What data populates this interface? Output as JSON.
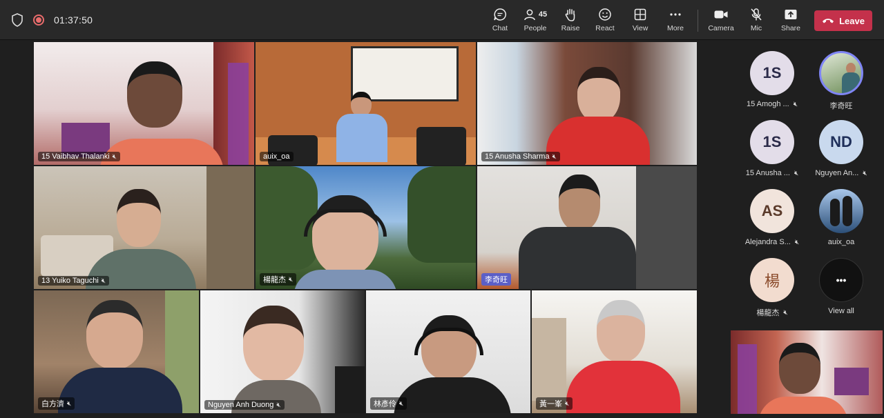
{
  "meeting": {
    "elapsed": "01:37:50"
  },
  "toolbar": {
    "chat": "Chat",
    "people": "People",
    "people_count": "45",
    "raise": "Raise",
    "react": "React",
    "view": "View",
    "more": "More",
    "camera": "Camera",
    "mic": "Mic",
    "share": "Share",
    "leave": "Leave"
  },
  "tiles": [
    {
      "name": "15 Vaibhav Thalanki"
    },
    {
      "name": "auix_oa"
    },
    {
      "name": "15 Anusha Sharma"
    },
    {
      "name": "13 Yuiko Taguchi"
    },
    {
      "name": "楊龍杰"
    },
    {
      "name": "李奇旺"
    },
    {
      "name": "白方濟"
    },
    {
      "name": "Nguyen Anh Duong"
    },
    {
      "name": "林彥伶"
    },
    {
      "name": "黃一峯"
    }
  ],
  "roster": [
    {
      "initials": "1S",
      "name": "15 Amogh ..."
    },
    {
      "initials": "",
      "name": "李奇旺"
    },
    {
      "initials": "1S",
      "name": "15 Anusha ..."
    },
    {
      "initials": "ND",
      "name": "Nguyen An..."
    },
    {
      "initials": "AS",
      "name": "Alejandra S..."
    },
    {
      "initials": "",
      "name": "auix_oa"
    },
    {
      "initials": "楊",
      "name": "楊龍杰"
    },
    {
      "initials": "•••",
      "name": "View all"
    }
  ],
  "colors": {
    "leave": "#c4314b",
    "highlight": "#5b5fc7",
    "avatar_bg": "#e3dde9",
    "avatar_bg_nd": "#c9d9ee"
  }
}
